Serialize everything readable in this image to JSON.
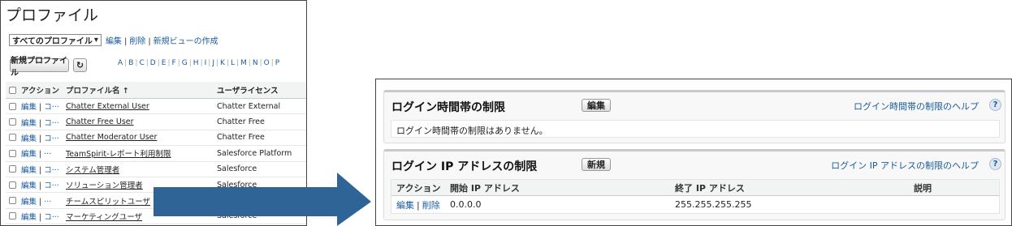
{
  "profile_list": {
    "title": "プロファイル",
    "view_select": "すべてのプロファイル",
    "view_links": {
      "edit": "編集",
      "delete": "削除",
      "new_view": "新規ビューの作成"
    },
    "new_button": "新規プロファイル",
    "refresh_icon": "refresh-icon",
    "alphabet": [
      "A",
      "B",
      "C",
      "D",
      "E",
      "F",
      "G",
      "H",
      "I",
      "J",
      "K",
      "L",
      "M",
      "N",
      "O",
      "P"
    ],
    "columns": {
      "action": "アクション",
      "name": "プロファイル名 ↑",
      "license": "ユーザライセンス"
    },
    "rows": [
      {
        "action_edit": "編集",
        "action_more": "コ···",
        "name": "Chatter External User",
        "license": "Chatter External",
        "linked": true
      },
      {
        "action_edit": "編集",
        "action_more": "コ···",
        "name": "Chatter Free User",
        "license": "Chatter Free",
        "linked": true
      },
      {
        "action_edit": "編集",
        "action_more": "コ···",
        "name": "Chatter Moderator User",
        "license": "Chatter Free",
        "linked": true
      },
      {
        "action_edit": "編集",
        "action_more": "···",
        "name": "TeamSpirit-レポート利用制限",
        "license": "Salesforce Platform",
        "linked": true
      },
      {
        "action_edit": "編集",
        "action_more": "コ···",
        "name": "システム管理者",
        "license": "Salesforce",
        "linked": true
      },
      {
        "action_edit": "編集",
        "action_more": "コ···",
        "name": "ソリューション管理者",
        "license": "Salesforce",
        "linked": true
      },
      {
        "action_edit": "編集",
        "action_more": "···",
        "name": "チームスピリットユーザ",
        "license": "",
        "linked": true
      },
      {
        "action_edit": "編集",
        "action_more": "コ···",
        "name": "マーケティングユーザ",
        "license": "Salesforce",
        "linked": true
      }
    ]
  },
  "arrow": {
    "color": "#2e6496"
  },
  "login_hours": {
    "title": "ログイン時間帯の制限",
    "edit_button": "編集",
    "help": "ログイン時間帯の制限のヘルプ",
    "help_icon": "?",
    "empty_message": "ログイン時間帯の制限はありません。"
  },
  "login_ip": {
    "title": "ログイン IP アドレスの制限",
    "new_button": "新規",
    "help": "ログイン IP アドレスの制限のヘルプ",
    "help_icon": "?",
    "columns": {
      "action": "アクション",
      "start_ip": "開始 IP アドレス",
      "end_ip": "終了 IP アドレス",
      "description": "説明"
    },
    "rows": [
      {
        "edit": "編集",
        "delete": "削除",
        "start_ip": "0.0.0.0",
        "end_ip": "255.255.255.255",
        "description": ""
      }
    ]
  }
}
